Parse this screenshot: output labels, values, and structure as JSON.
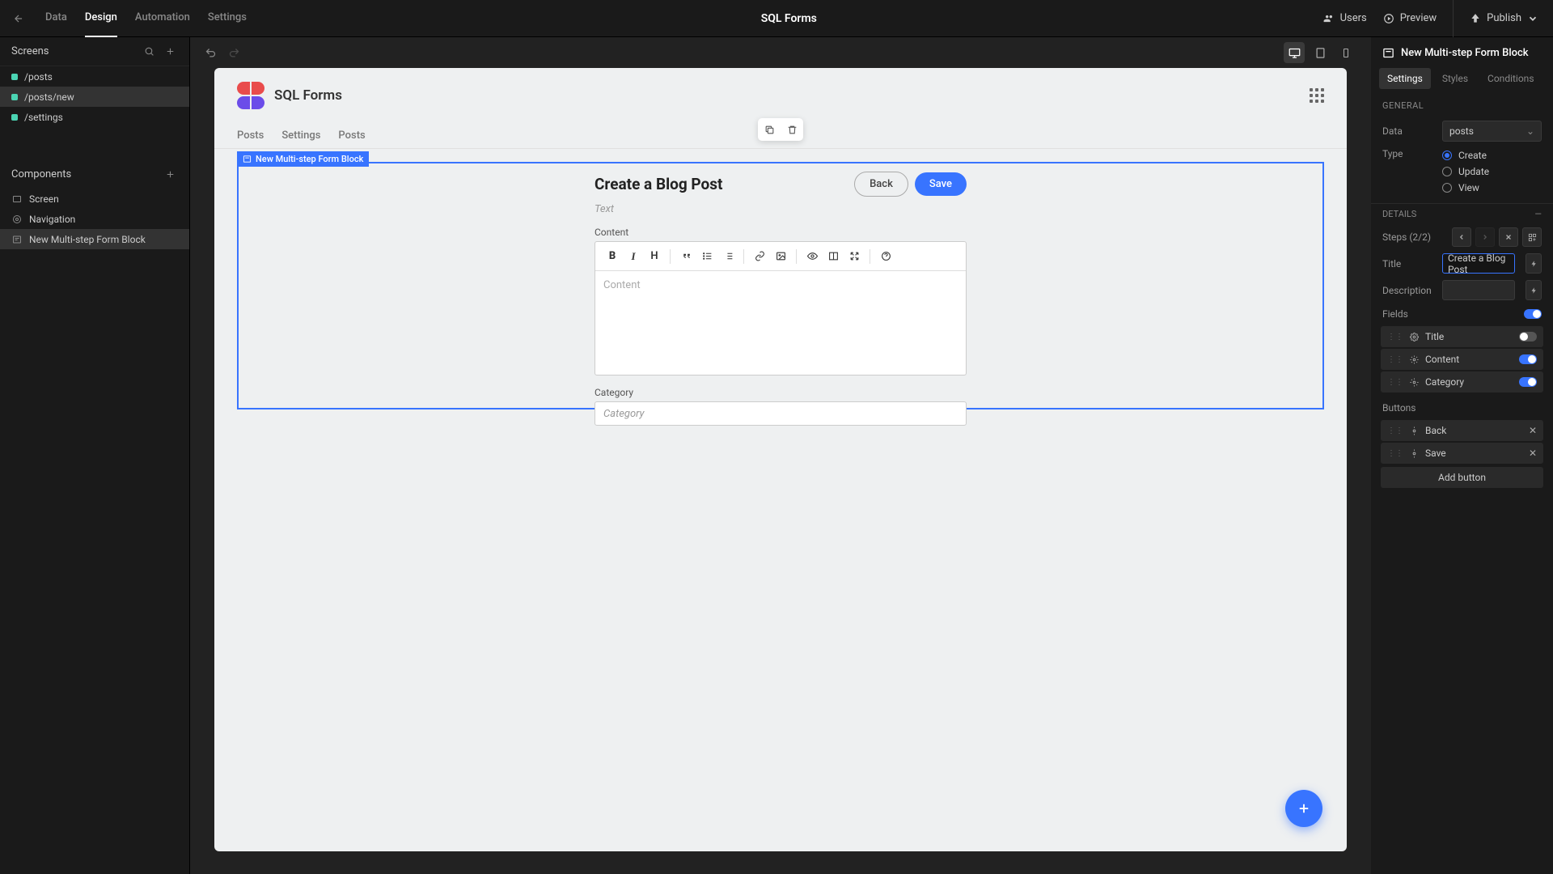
{
  "app_title": "SQL Forms",
  "main_tabs": [
    "Data",
    "Design",
    "Automation",
    "Settings"
  ],
  "top_actions": {
    "users": "Users",
    "preview": "Preview",
    "publish": "Publish"
  },
  "left": {
    "screens_hdr": "Screens",
    "screens": [
      "/posts",
      "/posts/new",
      "/settings"
    ],
    "components_hdr": "Components",
    "components": [
      "Screen",
      "Navigation",
      "New Multi-step Form Block"
    ]
  },
  "canvas": {
    "title": "SQL Forms",
    "tabs": [
      "Posts",
      "Settings",
      "Posts"
    ],
    "selection_label": "New Multi-step Form Block",
    "form_heading": "Create a Blog Post",
    "back": "Back",
    "save": "Save",
    "desc_placeholder": "Text",
    "content_label": "Content",
    "content_placeholder": "Content",
    "category_label": "Category",
    "category_placeholder": "Category"
  },
  "right": {
    "header": "New Multi-step Form Block",
    "tabs": [
      "Settings",
      "Styles",
      "Conditions"
    ],
    "general": "GENERAL",
    "data_label": "Data",
    "data_value": "posts",
    "type_label": "Type",
    "type_options": [
      "Create",
      "Update",
      "View"
    ],
    "details": "DETAILS",
    "steps_label": "Steps (2/2)",
    "title_label": "Title",
    "title_value": "Create a Blog Post",
    "desc_label": "Description",
    "fields_label": "Fields",
    "fields": [
      "Title",
      "Content",
      "Category"
    ],
    "buttons_label": "Buttons",
    "buttons": [
      "Back",
      "Save"
    ],
    "add_button": "Add button"
  }
}
